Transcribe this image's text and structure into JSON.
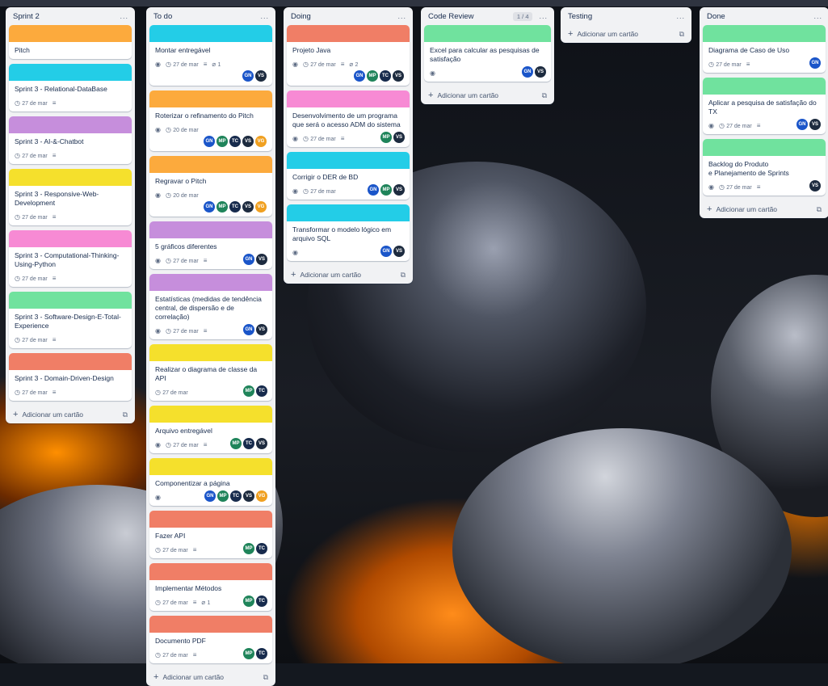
{
  "colors": {
    "orange": "#fcaa3d",
    "cyan": "#23cde7",
    "purple": "#c68edc",
    "yellow": "#f5e02c",
    "pink": "#f78ad4",
    "green": "#70e29e",
    "red": "#f07e66",
    "avatar_GN": "#1a55c9",
    "avatar_MP": "#1f845a",
    "avatar_TC": "#172b4d",
    "avatar_VS": "#1d2b3f",
    "avatar_VG": "#f0a020"
  },
  "add_card_label": "Adicionar um cartão",
  "lists": [
    {
      "title": "Sprint 2",
      "menu": "...",
      "cards": [
        {
          "cover": "orange",
          "title": "Pitch",
          "date": "",
          "eye": false,
          "desc": false,
          "attach": "",
          "members": []
        },
        {
          "cover": "cyan",
          "title": "Sprint 3 - Relational-DataBase",
          "date": "27 de mar",
          "eye": false,
          "desc": true,
          "attach": "",
          "members": []
        },
        {
          "cover": "purple",
          "title": "Sprint 3 - AI-&-Chatbot",
          "date": "27 de mar",
          "eye": false,
          "desc": true,
          "attach": "",
          "members": []
        },
        {
          "cover": "yellow",
          "title": "Sprint 3 - Responsive-Web-\nDevelopment",
          "date": "27 de mar",
          "eye": false,
          "desc": true,
          "attach": "",
          "members": []
        },
        {
          "cover": "pink",
          "title": "Sprint 3 - Computational-Thinking-\nUsing-Python",
          "date": "27 de mar",
          "eye": false,
          "desc": true,
          "attach": "",
          "members": []
        },
        {
          "cover": "green",
          "title": "Sprint 3 - Software-Design-E-Total-\nExperience",
          "date": "27 de mar",
          "eye": false,
          "desc": true,
          "attach": "",
          "members": []
        },
        {
          "cover": "red",
          "title": "Sprint 3 - Domain-Driven-Design",
          "date": "27 de mar",
          "eye": false,
          "desc": true,
          "attach": "",
          "members": []
        }
      ]
    },
    {
      "title": "To do",
      "menu": "...",
      "cards": [
        {
          "cover": "cyan",
          "title": "Montar entregável",
          "date": "27 de mar",
          "eye": true,
          "desc": true,
          "attach": "1",
          "members": [
            "GN",
            "VS"
          ]
        },
        {
          "cover": "orange",
          "title": "Roterizar o refinamento do Pitch",
          "date": "20 de mar",
          "eye": true,
          "desc": false,
          "attach": "",
          "members": [
            "GN",
            "MP",
            "TC",
            "VS",
            "VG"
          ]
        },
        {
          "cover": "orange",
          "title": "Regravar o Pitch",
          "date": "20 de mar",
          "eye": true,
          "desc": false,
          "attach": "",
          "members": [
            "GN",
            "MP",
            "TC",
            "VS",
            "VG"
          ]
        },
        {
          "cover": "purple",
          "title": "5 gráficos diferentes",
          "date": "27 de mar",
          "eye": true,
          "desc": true,
          "attach": "",
          "members": [
            "GN",
            "VS"
          ],
          "inline": true
        },
        {
          "cover": "purple",
          "title": "Estatísticas (medidas de tendência\ncentral, de dispersão e de correlação)",
          "date": "27 de mar",
          "eye": true,
          "desc": true,
          "attach": "",
          "members": [
            "GN",
            "VS"
          ],
          "inline": true
        },
        {
          "cover": "yellow",
          "title": "Realizar o diagrama de classe da API",
          "date": "27 de mar",
          "eye": false,
          "desc": false,
          "attach": "",
          "members": [
            "MP",
            "TC"
          ],
          "inline": true
        },
        {
          "cover": "yellow",
          "title": "Arquivo entregável",
          "date": "27 de mar",
          "eye": true,
          "desc": true,
          "attach": "",
          "members": [
            "MP",
            "TC",
            "VS"
          ],
          "inline": true
        },
        {
          "cover": "yellow",
          "title": "Componentizar a página",
          "date": "",
          "eye": true,
          "desc": false,
          "attach": "",
          "members": [
            "GN",
            "MP",
            "TC",
            "VS",
            "VG"
          ],
          "inline": true
        },
        {
          "cover": "red",
          "title": "Fazer API",
          "date": "27 de mar",
          "eye": false,
          "desc": true,
          "attach": "",
          "members": [
            "MP",
            "TC"
          ],
          "inline": true
        },
        {
          "cover": "red",
          "title": "Implementar Métodos",
          "date": "27 de mar",
          "eye": false,
          "desc": true,
          "attach": "1",
          "members": [
            "MP",
            "TC"
          ],
          "inline": true
        },
        {
          "cover": "red",
          "title": "Documento PDF",
          "date": "27 de mar",
          "eye": false,
          "desc": true,
          "attach": "",
          "members": [
            "MP",
            "TC"
          ],
          "inline": true
        }
      ]
    },
    {
      "title": "Doing",
      "menu": "...",
      "cards": [
        {
          "cover": "red",
          "title": "Projeto Java",
          "date": "27 de mar",
          "eye": true,
          "desc": true,
          "attach": "2",
          "members": [
            "GN",
            "MP",
            "TC",
            "VS"
          ]
        },
        {
          "cover": "pink",
          "title": "Desenvolvimento de um programa\nque será o acesso ADM do sistema",
          "date": "27 de mar",
          "eye": true,
          "desc": true,
          "attach": "",
          "members": [
            "MP",
            "VS"
          ],
          "inline": true
        },
        {
          "cover": "cyan",
          "title": "Corrigir o DER de BD",
          "date": "27 de mar",
          "eye": true,
          "desc": false,
          "attach": "",
          "members": [
            "GN",
            "MP",
            "VS"
          ],
          "inline": true
        },
        {
          "cover": "cyan",
          "title": "Transformar o modelo lógico em\narquivo SQL",
          "date": "",
          "eye": true,
          "desc": false,
          "attach": "",
          "members": [
            "GN",
            "VS"
          ],
          "inline": true
        }
      ]
    },
    {
      "title": "Code Review",
      "menu": "...",
      "badge": "1 / 4",
      "cards": [
        {
          "cover": "green",
          "title": "Excel para calcular as pesquisas de\nsatisfação",
          "date": "",
          "eye": true,
          "desc": false,
          "attach": "",
          "members": [
            "GN",
            "VS"
          ],
          "inline": true
        }
      ]
    },
    {
      "title": "Testing",
      "menu": "...",
      "cards": []
    },
    {
      "title": "Done",
      "menu": "...",
      "cards": [
        {
          "cover": "green",
          "title": "Diagrama de Caso de Uso",
          "date": "27 de mar",
          "eye": false,
          "desc": true,
          "attach": "",
          "members": [
            "GN"
          ],
          "inline": true
        },
        {
          "cover": "green",
          "title": "Aplicar a pesquisa de satisfação do TX",
          "date": "27 de mar",
          "eye": true,
          "desc": true,
          "attach": "",
          "members": [
            "GN",
            "VS"
          ],
          "inline": true
        },
        {
          "cover": "green",
          "title": "Backlog do Produto\ne Planejamento de Sprints",
          "date": "27 de mar",
          "eye": true,
          "desc": true,
          "attach": "",
          "members": [
            "VS"
          ],
          "inline": true
        }
      ]
    }
  ]
}
